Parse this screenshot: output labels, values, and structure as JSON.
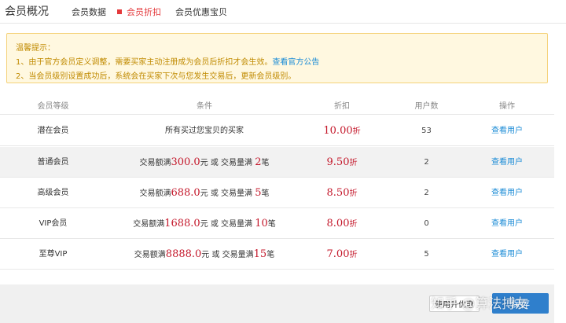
{
  "header": {
    "title": "会员概况",
    "tabs": [
      {
        "label": "会员数据"
      },
      {
        "label": "会员折扣"
      },
      {
        "label": "会员优惠宝贝"
      }
    ]
  },
  "tip": {
    "title": "温馨提示：",
    "line1": "1、由于官方会员定义调整，需要买家主动注册成为会员后折扣才会生效。",
    "line1_link": "查看官方公告",
    "line2": "2、当会员级别设置成功后，系统会在买家下次与您发生交易后，更新会员级别。"
  },
  "table": {
    "headers": [
      "会员等级",
      "条件",
      "折扣",
      "用户数",
      "操作"
    ],
    "rows": [
      {
        "level": "潜在会员",
        "cond_text": "所有买过您宝贝的买家",
        "discount": "10.00",
        "discount_unit": "折",
        "users": "53",
        "action": "查看用户"
      },
      {
        "level": "普通会员",
        "cond_a": "交易额满",
        "amount": "300.0",
        "cond_b": "元 或 交易量满 ",
        "count": "2",
        "cond_c": "笔",
        "discount": "9.50",
        "discount_unit": "折",
        "users": "2",
        "action": "查看用户"
      },
      {
        "level": "高级会员",
        "cond_a": "交易额满",
        "amount": "688.0",
        "cond_b": "元 或 交易量满 ",
        "count": "5",
        "cond_c": "笔",
        "discount": "8.50",
        "discount_unit": "折",
        "users": "2",
        "action": "查看用户"
      },
      {
        "level": "VIP会员",
        "cond_a": "交易额满",
        "amount": "1688.0",
        "cond_b": "元 或 交易量满 ",
        "count": "10",
        "cond_c": "笔",
        "discount": "8.00",
        "discount_unit": "折",
        "users": "0",
        "action": "查看用户"
      },
      {
        "level": "至尊VIP",
        "cond_a": "交易额满",
        "amount": "8888.0",
        "cond_b": "元 或 交易量满",
        "count": "15",
        "cond_c": "笔",
        "discount": "7.00",
        "discount_unit": "折",
        "users": "5",
        "action": "查看用户"
      }
    ]
  },
  "footer": {
    "link_label": "使用升优惠",
    "save_label": "保存",
    "watermark": "知乎 @算法搏友"
  },
  "colors": {
    "accent_red": "#e4393c",
    "link_blue": "#1a8bd6",
    "tip_bg": "#fff8e0",
    "button_blue": "#2f7fcc"
  }
}
